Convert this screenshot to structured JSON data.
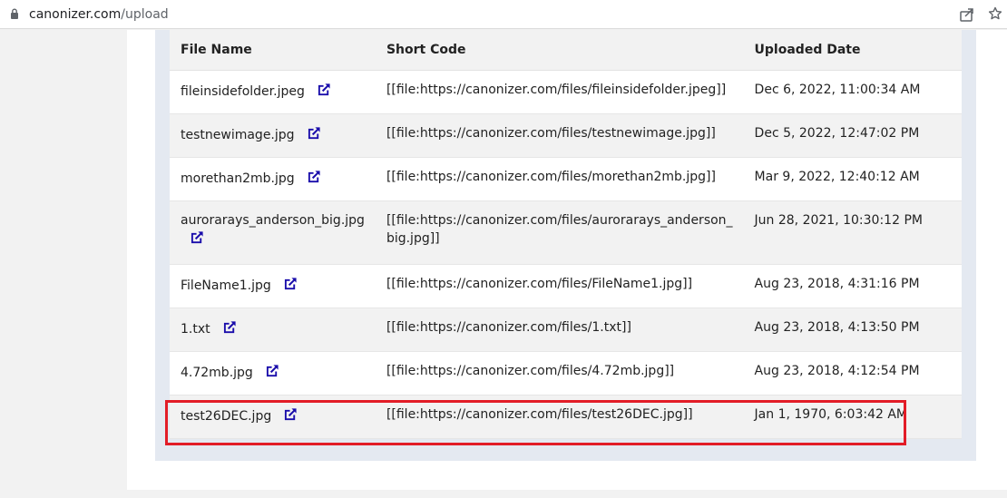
{
  "browser": {
    "url_host": "canonizer.com",
    "url_path": "/upload"
  },
  "table": {
    "headers": [
      "File Name",
      "Short Code",
      "Uploaded Date"
    ],
    "rows": [
      {
        "file_name": "fileinsidefolder.jpeg",
        "short_code": "[[file:https://canonizer.com/files/fileinsidefolder.jpeg]]",
        "date": "Dec 6, 2022, 11:00:34 AM"
      },
      {
        "file_name": "testnewimage.jpg",
        "short_code": "[[file:https://canonizer.com/files/testnewimage.jpg]]",
        "date": "Dec 5, 2022, 12:47:02 PM"
      },
      {
        "file_name": "morethan2mb.jpg",
        "short_code": "[[file:https://canonizer.com/files/morethan2mb.jpg]]",
        "date": "Mar 9, 2022, 12:40:12 AM"
      },
      {
        "file_name": "aurorarays_anderson_big.jpg",
        "short_code_line1": "[[file:https://canonizer.com/files/aurorarays_anderson_",
        "short_code_line2": "big.jpg]]",
        "date": "Jun 28, 2021, 10:30:12 PM"
      },
      {
        "file_name": "FileName1.jpg",
        "short_code": "[[file:https://canonizer.com/files/FileName1.jpg]]",
        "date": "Aug 23, 2018, 4:31:16 PM"
      },
      {
        "file_name": "1.txt",
        "short_code": "[[file:https://canonizer.com/files/1.txt]]",
        "date": "Aug 23, 2018, 4:13:50 PM"
      },
      {
        "file_name": "4.72mb.jpg",
        "short_code": "[[file:https://canonizer.com/files/4.72mb.jpg]]",
        "date": "Aug 23, 2018, 4:12:54 PM"
      },
      {
        "file_name": "test26DEC.jpg",
        "short_code": "[[file:https://canonizer.com/files/test26DEC.jpg]]",
        "date": "Jan 1, 1970, 6:03:42 AM"
      }
    ]
  },
  "icons": {
    "external_link": "external-link-icon",
    "lock": "lock-icon",
    "share": "share-icon",
    "star": "star-icon"
  },
  "colors": {
    "link_icon": "#1a0dab",
    "highlight_border": "#e21c27",
    "header_bg": "#f2f2f2",
    "panel_bg": "#e4e9f1"
  }
}
